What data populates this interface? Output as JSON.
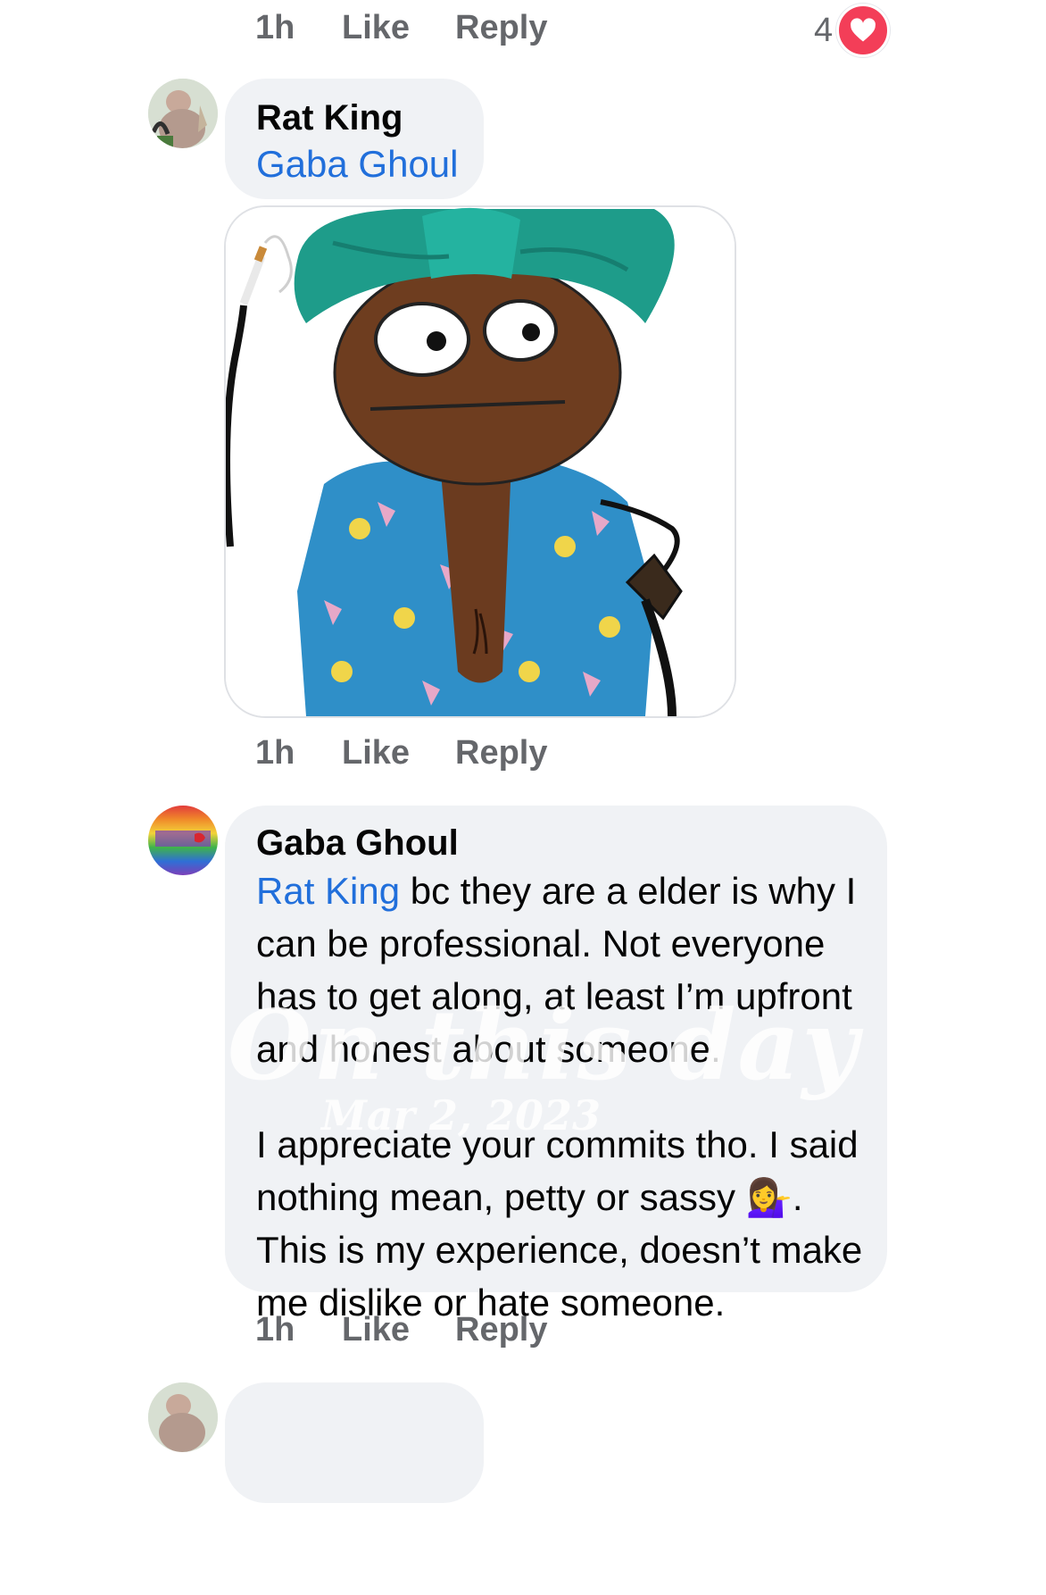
{
  "top_actions": {
    "time": "1h",
    "like": "Like",
    "reply": "Reply",
    "reaction_count": "4"
  },
  "comment_rat_king": {
    "author": "Rat King",
    "mention": "Gaba Ghoul",
    "actions": {
      "time": "1h",
      "like": "Like",
      "reply": "Reply"
    }
  },
  "comment_gaba_ghoul": {
    "author": "Gaba Ghoul",
    "mention": "Rat King",
    "lines": [
      " bc they are a elder is why I",
      "can be professional. Not everyone",
      "has to get along, at least I’m upfront",
      "and honest about someone.",
      "I appreciate your commits tho. I said",
      "nothing mean, petty or sassy 💁‍♀️.",
      "This is my experience, doesn’t make",
      "me dislike or hate someone."
    ],
    "actions": {
      "time": "1h",
      "like": "Like",
      "reply": "Reply"
    }
  },
  "watermark": {
    "line1": "On this day",
    "line2": "Mar 2, 2023"
  },
  "colors": {
    "mention": "#216fdb",
    "bubble": "#f0f2f5",
    "meta": "#65676b",
    "heart": "#f33e58"
  }
}
